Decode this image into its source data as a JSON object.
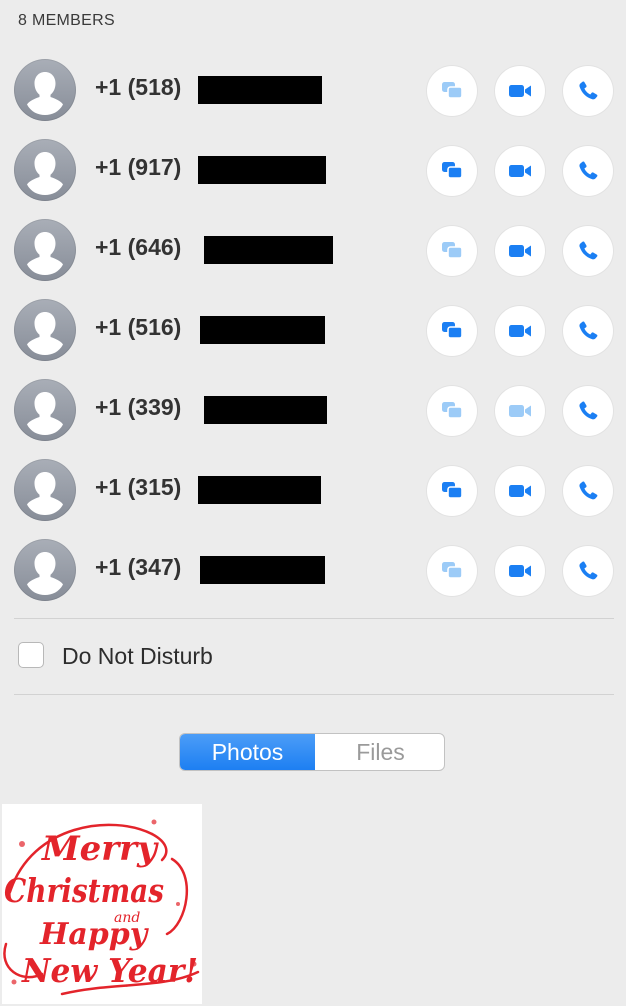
{
  "header": {
    "members_label": "8 MEMBERS"
  },
  "members": [
    {
      "phone": "+1 (518)",
      "message_enabled": false,
      "video_enabled": true,
      "call_enabled": true
    },
    {
      "phone": "+1 (917)",
      "message_enabled": true,
      "video_enabled": true,
      "call_enabled": true
    },
    {
      "phone": "+1 (646)",
      "message_enabled": false,
      "video_enabled": true,
      "call_enabled": true
    },
    {
      "phone": "+1 (516)",
      "message_enabled": true,
      "video_enabled": true,
      "call_enabled": true
    },
    {
      "phone": "+1 (339)",
      "message_enabled": false,
      "video_enabled": false,
      "call_enabled": true
    },
    {
      "phone": "+1 (315)",
      "message_enabled": true,
      "video_enabled": true,
      "call_enabled": true
    },
    {
      "phone": "+1 (347)",
      "message_enabled": false,
      "video_enabled": true,
      "call_enabled": true
    }
  ],
  "dnd": {
    "label": "Do Not Disturb",
    "checked": false
  },
  "tabs": {
    "photos": "Photos",
    "files": "Files",
    "selected": "photos"
  },
  "attachment": {
    "line1": "Merry",
    "line2": "Christmas",
    "line3": "and",
    "line4": "Happy",
    "line5": "New Year!"
  },
  "colors": {
    "accent": "#1b7ff3",
    "accent_disabled": "#9ccbf7",
    "greeting_red": "#e3242b",
    "background": "#ececec"
  },
  "icons": {
    "avatar": "person-silhouette-icon",
    "message": "message-bubbles-icon",
    "video": "video-camera-icon",
    "call": "phone-handset-icon"
  }
}
